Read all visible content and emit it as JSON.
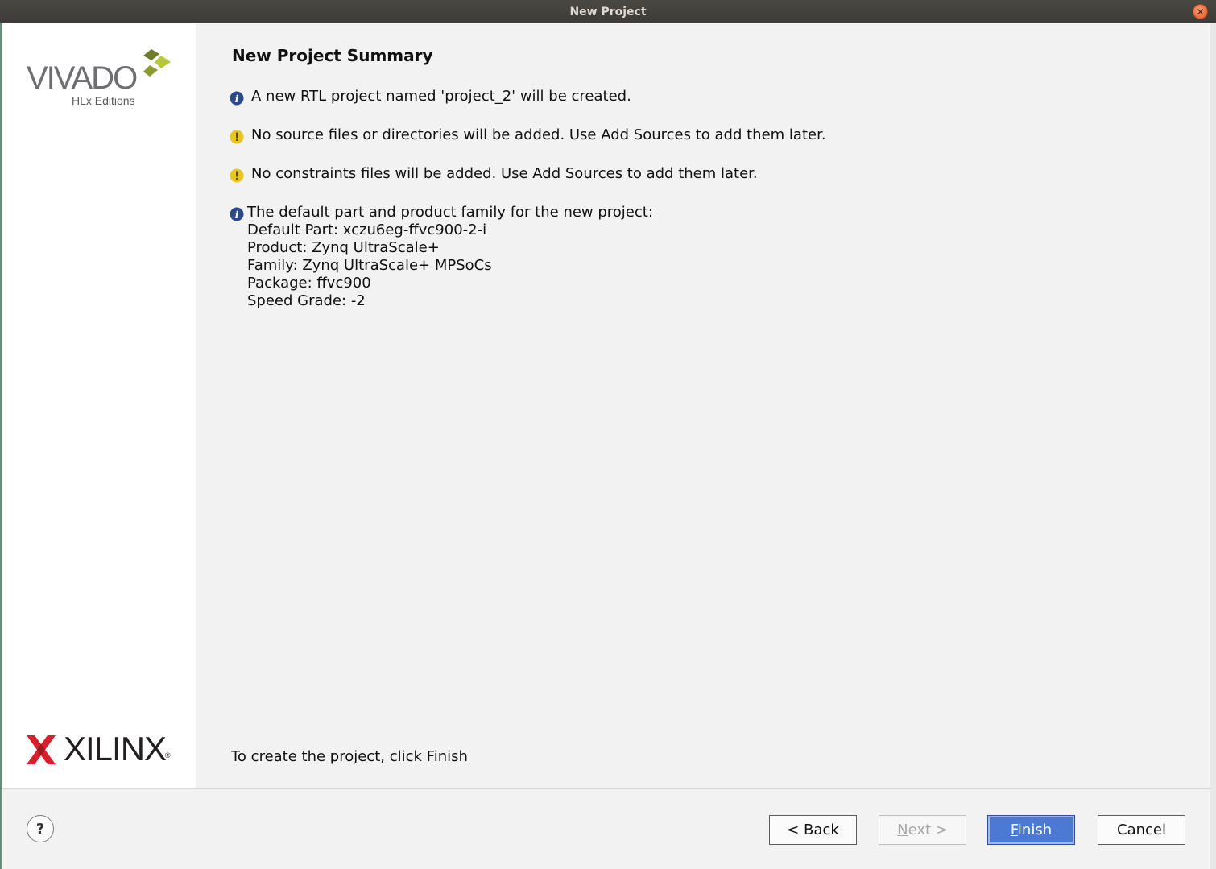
{
  "window": {
    "title": "New Project"
  },
  "sidebar": {
    "vivado_logo": {
      "name": "VIVADO",
      "sub": "HLx Editions"
    },
    "xilinx_logo": {
      "name": "XILINX",
      "reg": "®"
    }
  },
  "main": {
    "heading": "New Project Summary",
    "messages": [
      {
        "icon": "info-icon",
        "text": "A new RTL project named 'project_2' will be created."
      },
      {
        "icon": "warning-icon",
        "text": "No source files or directories will be added. Use Add Sources to add them later."
      },
      {
        "icon": "warning-icon",
        "text": "No constraints files will be added. Use Add Sources to add them later."
      }
    ],
    "part_info": {
      "icon": "info-icon",
      "intro": "The default part and product family for the new project:",
      "lines": [
        "Default Part: xczu6eg-ffvc900-2-i",
        "Product: Zynq UltraScale+",
        "Family: Zynq UltraScale+ MPSoCs",
        "Package: ffvc900",
        "Speed Grade: -2"
      ]
    },
    "finish_hint": "To create the project, click Finish"
  },
  "footer": {
    "help_label": "?",
    "back": {
      "label": "< Back"
    },
    "next": {
      "label_prefix": "",
      "mnemonic": "N",
      "label_rest": "ext >"
    },
    "finish": {
      "mnemonic": "F",
      "label_rest": "inish"
    },
    "cancel": {
      "label": "Cancel"
    }
  },
  "colors": {
    "info": "#2b4a86",
    "warning": "#e8c520",
    "primary_button": "#4b79d3",
    "xilinx_red": "#d6202b",
    "vivado_green": "#b7c93a"
  }
}
